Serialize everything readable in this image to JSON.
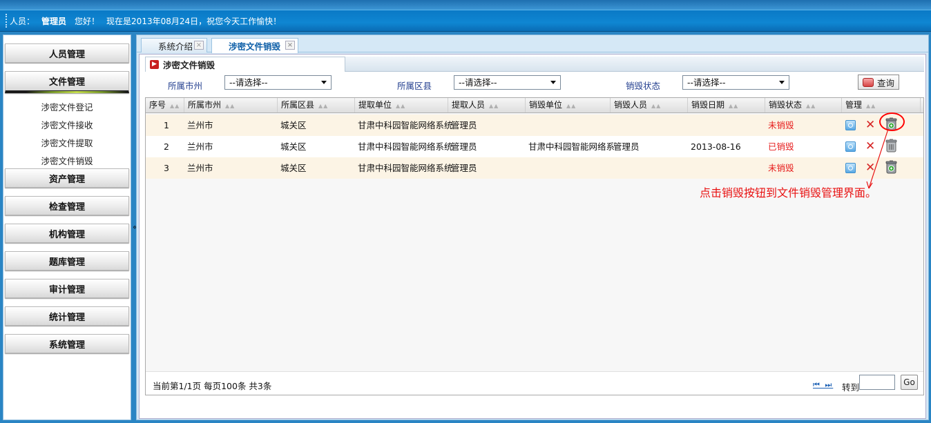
{
  "status": {
    "user_label": "人员：",
    "user_name": "管理员",
    "greeting": "您好！",
    "message": "现在是2013年08月24日，祝您今天工作愉快！"
  },
  "sidebar": {
    "menus": [
      {
        "label": "人员管理"
      },
      {
        "label": "文件管理"
      },
      {
        "label": "资产管理"
      },
      {
        "label": "检查管理"
      },
      {
        "label": "机构管理"
      },
      {
        "label": "题库管理"
      },
      {
        "label": "审计管理"
      },
      {
        "label": "统计管理"
      },
      {
        "label": "系统管理"
      }
    ],
    "submenu": [
      {
        "label": "涉密文件登记"
      },
      {
        "label": "涉密文件接收"
      },
      {
        "label": "涉密文件提取"
      },
      {
        "label": "涉密文件销毁"
      }
    ],
    "collapse": "«"
  },
  "tabs": [
    {
      "label": "系统介绍",
      "close": "×"
    },
    {
      "label": "涉密文件销毁",
      "close": "×"
    }
  ],
  "section": {
    "title": "涉密文件销毁"
  },
  "filters": {
    "city_label": "所属市州",
    "city_value": "--请选择--",
    "district_label": "所属区县",
    "district_value": "--请选择--",
    "status_label": "销毁状态",
    "status_value": "--请选择--",
    "query": "查询"
  },
  "table": {
    "columns": [
      "序号",
      "所属市州",
      "所属区县",
      "提取单位",
      "提取人员",
      "销毁单位",
      "销毁人员",
      "销毁日期",
      "销毁状态",
      "管理"
    ],
    "rows": [
      {
        "no": "1",
        "city": "兰州市",
        "district": "城关区",
        "extract_unit": "甘肃中科园智能网络系统",
        "extract_person": "管理员",
        "destroy_unit": "",
        "destroy_person": "",
        "date": "",
        "state": "未销毁"
      },
      {
        "no": "2",
        "city": "兰州市",
        "district": "城关区",
        "extract_unit": "甘肃中科园智能网络系统",
        "extract_person": "管理员",
        "destroy_unit": "甘肃中科园智能网络系",
        "destroy_person": "管理员",
        "date": "2013-08-16",
        "state": "已销毁"
      },
      {
        "no": "3",
        "city": "兰州市",
        "district": "城关区",
        "extract_unit": "甘肃中科园智能网络系统",
        "extract_person": "管理员",
        "destroy_unit": "",
        "destroy_person": "",
        "date": "",
        "state": "未销毁"
      }
    ],
    "sort_glyph": "▲▲"
  },
  "annotation": "点击销毁按钮到文件销毁管理界面。",
  "pager": {
    "info": "当前第1/1页  每页100条  共3条",
    "nav": "⏮ ⏭",
    "goto_label": "转到",
    "go": "Go"
  },
  "icons": [
    "view-icon",
    "delete-icon",
    "destroy-trash-icon"
  ],
  "colors": {
    "accent": "#0a79c6",
    "status_red": "#e61c1c",
    "row_alt": "#fcf4e5"
  }
}
